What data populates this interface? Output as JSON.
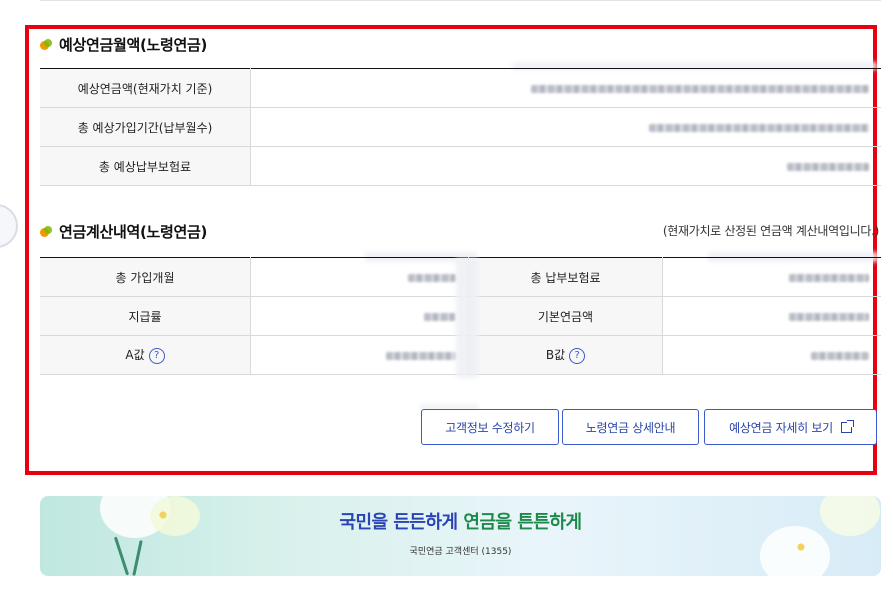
{
  "section1": {
    "title": "예상연금월액(노령연금)",
    "rows": [
      {
        "label": "예상연금액(현재가치 기준)",
        "value": ""
      },
      {
        "label": "총 예상가입기간(납부월수)",
        "value": ""
      },
      {
        "label": "총 예상납부보험료",
        "value": ""
      }
    ]
  },
  "section2": {
    "title": "연금계산내역(노령연금)",
    "note": "(현재가치로 산정된 연금액 계산내역입니다.)",
    "rows": [
      {
        "label1": "총 가입개월",
        "label2": "총 납부보험료"
      },
      {
        "label1": "지급률",
        "label2": "기본연금액"
      },
      {
        "label1": "A값",
        "label2": "B값"
      }
    ],
    "help_icon": "?"
  },
  "buttons": {
    "edit_info": "고객정보 수정하기",
    "old_age_pension_info": "노령연금 상세안내",
    "view_details": "예상연금 자세히 보기"
  },
  "banner": {
    "title_part1": "국민을 든든하게",
    "title_part2": "연금을 튼튼하게",
    "subtitle": "국민연금 고객센터 (1355)"
  },
  "colors": {
    "highlight_border": "#e60012",
    "button_text": "#2a45a8"
  }
}
